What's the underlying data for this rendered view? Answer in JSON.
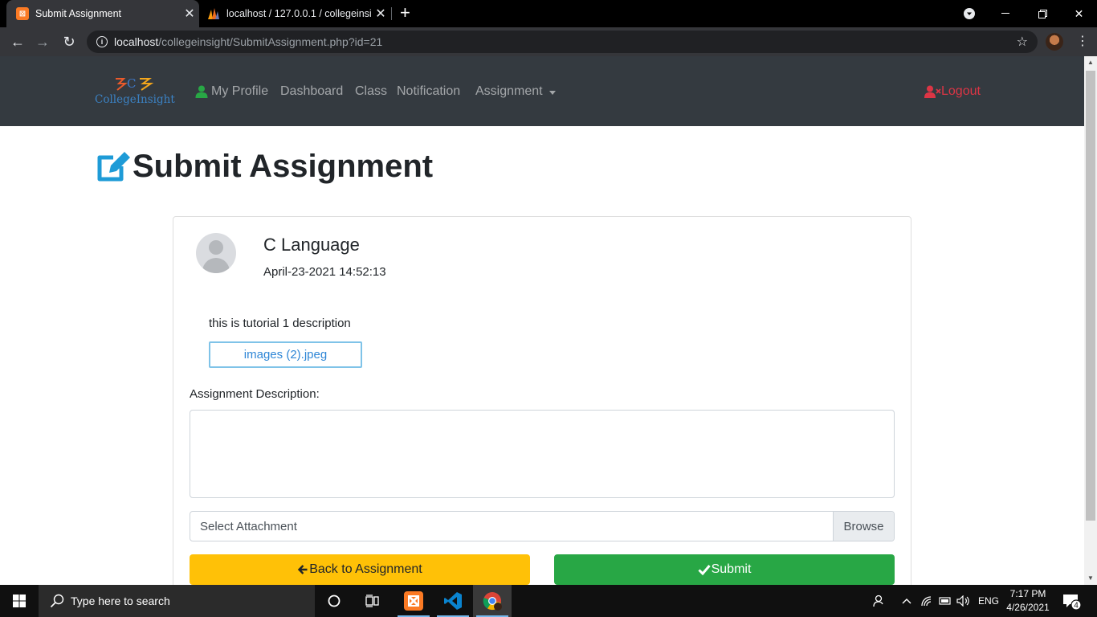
{
  "browser": {
    "tabs": [
      {
        "title": "Submit Assignment",
        "active": true
      },
      {
        "title": "localhost / 127.0.0.1 / collegeinsight",
        "active": false
      }
    ],
    "url_host": "localhost",
    "url_path": "/collegeinsight/SubmitAssignment.php?id=21"
  },
  "nav": {
    "logo_text": "CollegeInsight",
    "items": [
      {
        "label": "My Profile"
      },
      {
        "label": "Dashboard"
      },
      {
        "label": "Class"
      },
      {
        "label": "Notification"
      },
      {
        "label": "Assignment"
      }
    ],
    "logout": "Logout"
  },
  "page": {
    "title": "Submit Assignment"
  },
  "assignment": {
    "subject": "C Language",
    "date": "April-23-2021 14:52:13",
    "description": "this is tutorial 1 description",
    "file_name": "images (2).jpeg"
  },
  "form": {
    "description_label": "Assignment Description:",
    "description_value": "",
    "attachment_placeholder": "Select Attachment",
    "browse_label": "Browse",
    "back_label": "Back to Assignment",
    "submit_label": "Submit"
  },
  "taskbar": {
    "search_placeholder": "Type here to search",
    "language": "ENG",
    "time": "7:17 PM",
    "date": "4/26/2021",
    "notification_count": "4"
  },
  "colors": {
    "navbar_bg": "#343a40",
    "logout": "#dc3545",
    "back_button": "#ffc107",
    "submit_button": "#28a745",
    "edit_icon": "#1e9bd7",
    "profile_icon": "#28a745"
  }
}
